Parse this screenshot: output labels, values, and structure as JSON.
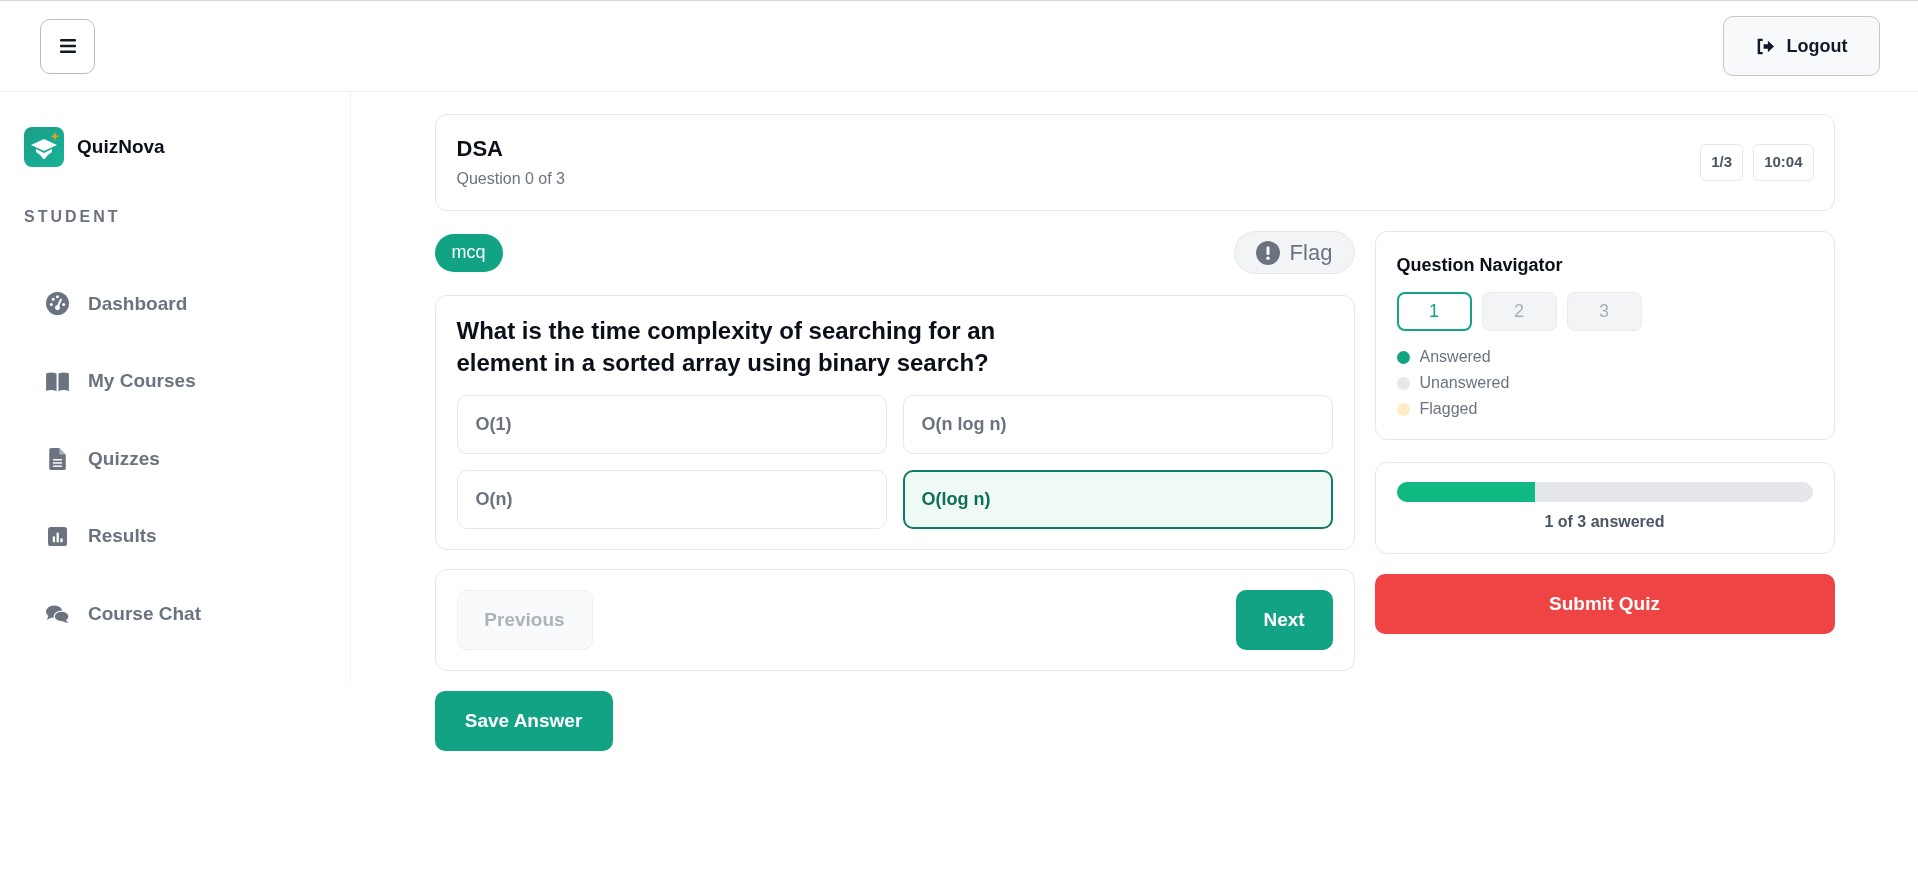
{
  "top_bar": {
    "logout": "Logout"
  },
  "sidebar": {
    "brand": "QuizNova",
    "section": "STUDENT",
    "items": [
      {
        "label": "Dashboard",
        "selected": false
      },
      {
        "label": "My Courses",
        "selected": false
      },
      {
        "label": "Quizzes",
        "selected": false
      },
      {
        "label": "Results",
        "selected": false
      },
      {
        "label": "Course Chat",
        "selected": false
      }
    ]
  },
  "quiz_header": {
    "title": "DSA",
    "subtitle": "Question 0 of 3",
    "counter": "1/3",
    "timer": "10:04"
  },
  "question": {
    "badge": "mcq",
    "flag": {
      "label": "Flag",
      "flagged": false
    },
    "text": "What is the time complexity of searching for an element in a sorted array using binary search?",
    "options": [
      {
        "label": "O(1)",
        "selected": false
      },
      {
        "label": "O(n log n)",
        "selected": false
      },
      {
        "label": "O(n)",
        "selected": false
      },
      {
        "label": "O(log n)",
        "selected": true
      }
    ]
  },
  "navigation": {
    "previous": {
      "label": "Previous",
      "disabled": true
    },
    "next": {
      "label": "Next",
      "disabled": false
    }
  },
  "save_button": "Save Answer",
  "navigator": {
    "title": "Question Navigator",
    "questions": [
      {
        "label": "1",
        "selected": true
      },
      {
        "label": "2",
        "selected": false
      },
      {
        "label": "3",
        "selected": false
      }
    ],
    "legend": [
      {
        "label": "Answered",
        "color": "#13a383"
      },
      {
        "label": "Unanswered",
        "color": "#e5e7eb"
      },
      {
        "label": "Flagged",
        "color": "#fdecc6"
      }
    ]
  },
  "progress": {
    "level": 0.333,
    "text": "1 of 3 answered"
  },
  "submit_button": "Submit Quiz"
}
